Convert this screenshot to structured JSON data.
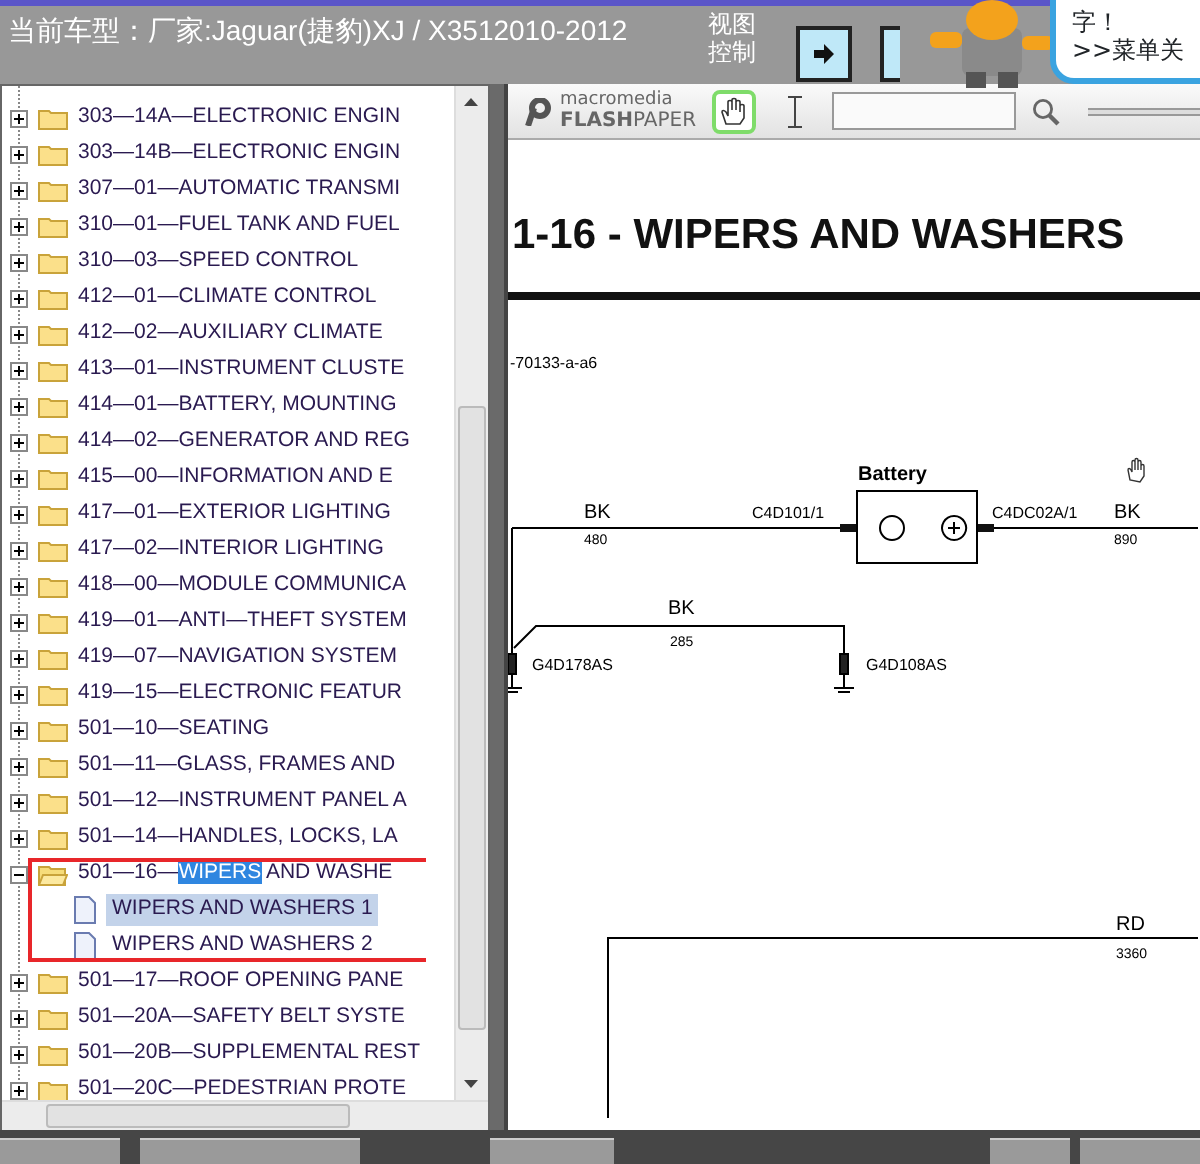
{
  "header": {
    "title": "当前车型：厂家:Jaguar(捷豹)XJ / X3512010-2012",
    "view_control": "视图控制",
    "bubble_lines": [
      "字！",
      ">>菜单关"
    ]
  },
  "tree": [
    {
      "label": "303—14A—ELECTRONIC ENGIN",
      "expanded": false
    },
    {
      "label": "303—14B—ELECTRONIC ENGIN",
      "expanded": false
    },
    {
      "label": "307—01—AUTOMATIC TRANSMI",
      "expanded": false
    },
    {
      "label": "310—01—FUEL TANK AND FUEL",
      "expanded": false
    },
    {
      "label": "310—03—SPEED CONTROL",
      "expanded": false
    },
    {
      "label": "412—01—CLIMATE CONTROL",
      "expanded": false
    },
    {
      "label": "412—02—AUXILIARY CLIMATE",
      "expanded": false
    },
    {
      "label": "413—01—INSTRUMENT CLUSTE",
      "expanded": false
    },
    {
      "label": "414—01—BATTERY, MOUNTING",
      "expanded": false
    },
    {
      "label": "414—02—GENERATOR AND REG",
      "expanded": false
    },
    {
      "label": "415—00—INFORMATION AND E",
      "expanded": false
    },
    {
      "label": "417—01—EXTERIOR LIGHTING",
      "expanded": false
    },
    {
      "label": "417—02—INTERIOR LIGHTING",
      "expanded": false
    },
    {
      "label": "418—00—MODULE COMMUNICA",
      "expanded": false
    },
    {
      "label": "419—01—ANTI—THEFT SYSTEM",
      "expanded": false
    },
    {
      "label": "419—07—NAVIGATION SYSTEM",
      "expanded": false
    },
    {
      "label": "419—15—ELECTRONIC FEATUR",
      "expanded": false
    },
    {
      "label": "501—10—SEATING",
      "expanded": false
    },
    {
      "label": "501—11—GLASS, FRAMES AND",
      "expanded": false
    },
    {
      "label": "501—12—INSTRUMENT PANEL A",
      "expanded": false
    },
    {
      "label": "501—14—HANDLES, LOCKS, LA",
      "expanded": false
    },
    {
      "label_start": "501—16—",
      "match": "WIPERS",
      "label_end": " AND WASHE",
      "expanded": true,
      "children": [
        {
          "label": "WIPERS AND WASHERS 1",
          "selected": true
        },
        {
          "label": "WIPERS AND WASHERS 2",
          "selected": false
        }
      ]
    },
    {
      "label": "501—17—ROOF OPENING PANE",
      "expanded": false
    },
    {
      "label": "501—20A—SAFETY BELT SYSTE",
      "expanded": false
    },
    {
      "label": "501—20B—SUPPLEMENTAL REST",
      "expanded": false
    },
    {
      "label": "501—20C—PEDESTRIAN PROTE",
      "expanded": false
    }
  ],
  "viewer": {
    "logo_small": "macromedia",
    "logo_big": "**FLASH**PAPER",
    "tools": [
      {
        "kind": "hand",
        "selected": true
      },
      {
        "kind": "text",
        "selected": false
      }
    ],
    "document": {
      "title": "1-16 - WIPERS AND WASHERS",
      "figure_id": "-70133-a-a6",
      "diagram_texts": [
        {
          "kind": "component",
          "text": "Battery"
        },
        {
          "kind": "wire_color",
          "text": "BK"
        },
        {
          "kind": "wire_number",
          "text": "480"
        },
        {
          "kind": "connector",
          "text": "C4D101/1"
        },
        {
          "kind": "connector",
          "text": "C4DC02A/1"
        },
        {
          "kind": "wire_color",
          "text": "BK"
        },
        {
          "kind": "wire_number",
          "text": "890"
        },
        {
          "kind": "wire_color",
          "text": "BK"
        },
        {
          "kind": "wire_number",
          "text": "285"
        },
        {
          "kind": "connector",
          "text": "G4D178AS"
        },
        {
          "kind": "connector",
          "text": "G4D108AS"
        },
        {
          "kind": "wire_color",
          "text": "RD"
        },
        {
          "kind": "wire_number",
          "text": "3360"
        }
      ]
    }
  }
}
